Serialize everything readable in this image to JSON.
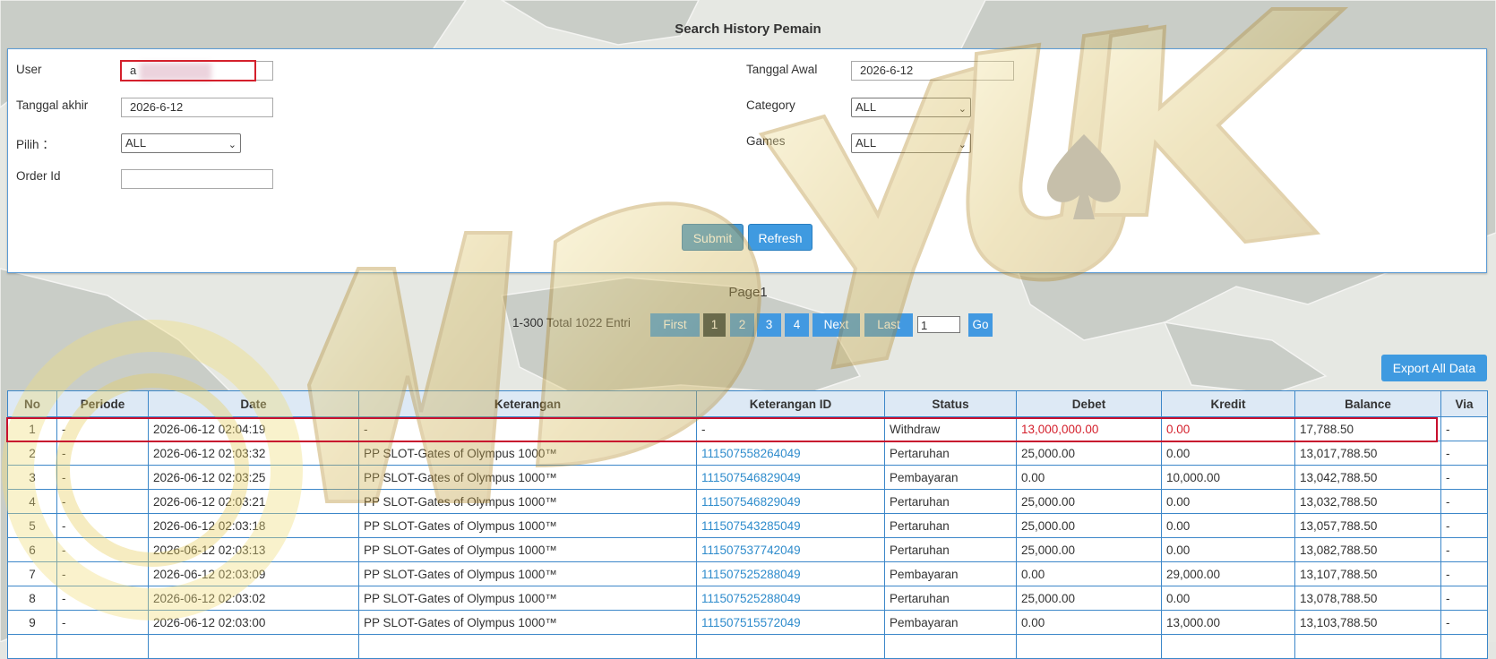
{
  "page": {
    "title": "Search History Pemain"
  },
  "form": {
    "user": {
      "label": "User",
      "value": "a"
    },
    "tanggal_akhir": {
      "label": "Tanggal akhir",
      "value": "2026-6-12"
    },
    "pilih": {
      "label": "Pilih ：",
      "selected": "ALL"
    },
    "order_id": {
      "label": "Order Id",
      "value": ""
    },
    "tanggal_awal": {
      "label": "Tanggal Awal",
      "value": "2026-6-12"
    },
    "category": {
      "label": "Category",
      "selected": "ALL"
    },
    "games": {
      "label": "Games",
      "selected": "ALL"
    },
    "submit_label": "Submit",
    "refresh_label": "Refresh"
  },
  "pagination": {
    "title": "Page1",
    "info": "1-300 Total 1022 Entri",
    "first_label": "First",
    "pages": [
      "1",
      "2",
      "3",
      "4"
    ],
    "active_page": "1",
    "next_label": "Next",
    "last_label": "Last",
    "page_input": "1",
    "go_label": "Go"
  },
  "export_label": "Export All Data",
  "table": {
    "columns": [
      "No",
      "Periode",
      "Date",
      "Keterangan",
      "Keterangan ID",
      "Status",
      "Debet",
      "Kredit",
      "Balance",
      "Via"
    ],
    "rows": [
      [
        "1",
        "-",
        "2026-06-12 02:04:19",
        "-",
        "-",
        "Withdraw",
        "13,000,000.00",
        "0.00",
        "17,788.50",
        "-"
      ],
      [
        "2",
        "-",
        "2026-06-12 02:03:32",
        "PP SLOT-Gates of Olympus 1000™",
        "111507558264049",
        "Pertaruhan",
        "25,000.00",
        "0.00",
        "13,017,788.50",
        "-"
      ],
      [
        "3",
        "-",
        "2026-06-12 02:03:25",
        "PP SLOT-Gates of Olympus 1000™",
        "111507546829049",
        "Pembayaran",
        "0.00",
        "10,000.00",
        "13,042,788.50",
        "-"
      ],
      [
        "4",
        "-",
        "2026-06-12 02:03:21",
        "PP SLOT-Gates of Olympus 1000™",
        "111507546829049",
        "Pertaruhan",
        "25,000.00",
        "0.00",
        "13,032,788.50",
        "-"
      ],
      [
        "5",
        "-",
        "2026-06-12 02:03:18",
        "PP SLOT-Gates of Olympus 1000™",
        "111507543285049",
        "Pertaruhan",
        "25,000.00",
        "0.00",
        "13,057,788.50",
        "-"
      ],
      [
        "6",
        "-",
        "2026-06-12 02:03:13",
        "PP SLOT-Gates of Olympus 1000™",
        "111507537742049",
        "Pertaruhan",
        "25,000.00",
        "0.00",
        "13,082,788.50",
        "-"
      ],
      [
        "7",
        "-",
        "2026-06-12 02:03:09",
        "PP SLOT-Gates of Olympus 1000™",
        "111507525288049",
        "Pembayaran",
        "0.00",
        "29,000.00",
        "13,107,788.50",
        "-"
      ],
      [
        "8",
        "-",
        "2026-06-12 02:03:02",
        "PP SLOT-Gates of Olympus 1000™",
        "111507525288049",
        "Pertaruhan",
        "25,000.00",
        "0.00",
        "13,078,788.50",
        "-"
      ],
      [
        "9",
        "-",
        "2026-06-12 02:03:00",
        "PP SLOT-Gates of Olympus 1000™",
        "111507515572049",
        "Pembayaran",
        "0.00",
        "13,000.00",
        "13,103,788.50",
        "-"
      ],
      [
        "",
        "",
        "",
        "",
        "",
        "",
        "",
        "",
        "",
        ""
      ]
    ]
  },
  "colors": {
    "accent": "#4299e1",
    "highlight": "#c8102e",
    "link": "#2f8ccc",
    "header_bg": "#dde9f5"
  },
  "watermark": {
    "text": "WDYUK"
  }
}
